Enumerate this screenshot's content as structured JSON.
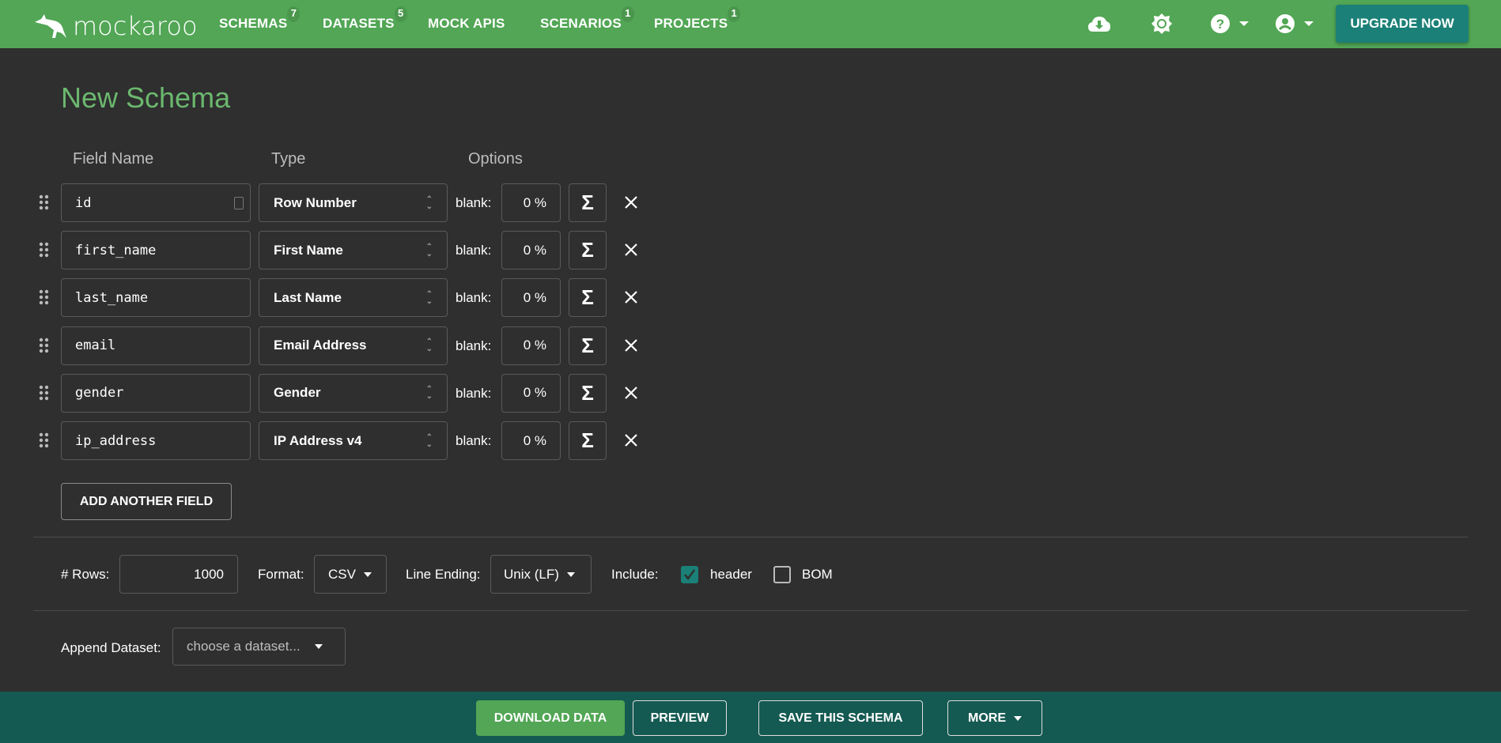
{
  "nav": {
    "logo_text": "mockaroo",
    "items": [
      {
        "label": "SCHEMAS",
        "badge": "7"
      },
      {
        "label": "DATASETS",
        "badge": "5"
      },
      {
        "label": "MOCK APIS",
        "badge": null
      },
      {
        "label": "SCENARIOS",
        "badge": "1"
      },
      {
        "label": "PROJECTS",
        "badge": "1"
      }
    ],
    "icons": [
      "cloud-download-icon",
      "brightness-icon",
      "help-icon",
      "account-icon"
    ],
    "upgrade_label": "UPGRADE NOW"
  },
  "page": {
    "title": "New Schema",
    "columns": {
      "field_name": "Field Name",
      "type": "Type",
      "options": "Options"
    }
  },
  "fields": [
    {
      "name": "id",
      "type": "Row Number",
      "blank_label": "blank:",
      "blank": "0 %"
    },
    {
      "name": "first_name",
      "type": "First Name",
      "blank_label": "blank:",
      "blank": "0 %"
    },
    {
      "name": "last_name",
      "type": "Last Name",
      "blank_label": "blank:",
      "blank": "0 %"
    },
    {
      "name": "email",
      "type": "Email Address",
      "blank_label": "blank:",
      "blank": "0 %"
    },
    {
      "name": "gender",
      "type": "Gender",
      "blank_label": "blank:",
      "blank": "0 %"
    },
    {
      "name": "ip_address",
      "type": "IP Address v4",
      "blank_label": "blank:",
      "blank": "0 %"
    }
  ],
  "add_field_label": "ADD ANOTHER FIELD",
  "options": {
    "rows_label": "# Rows:",
    "rows": "1000",
    "format_label": "Format:",
    "format": "CSV",
    "line_ending_label": "Line Ending:",
    "line_ending": "Unix (LF)",
    "include_label": "Include:",
    "header_label": "header",
    "header_checked": true,
    "bom_label": "BOM",
    "bom_checked": false,
    "append_label": "Append Dataset:",
    "append_placeholder": "choose a dataset..."
  },
  "footer": {
    "download": "DOWNLOAD DATA",
    "preview": "PREVIEW",
    "save": "SAVE THIS SCHEMA",
    "more": "MORE"
  },
  "colors": {
    "nav": "#52a655",
    "accent": "#1b8077",
    "footer": "#155a52",
    "title": "#6bb86e"
  }
}
